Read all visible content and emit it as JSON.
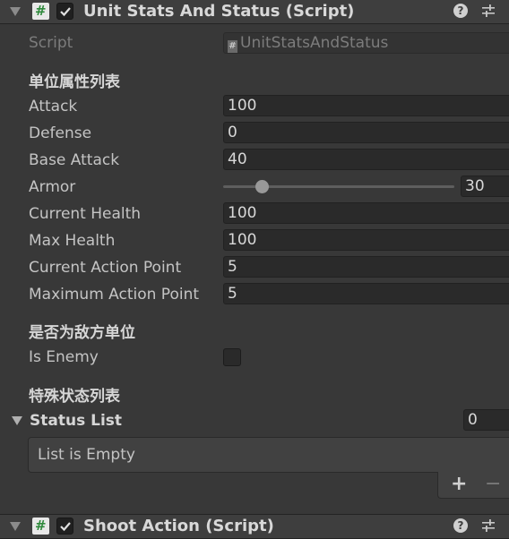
{
  "component1": {
    "title": "Unit Stats And Status (Script)",
    "script_label": "Script",
    "script_value": "UnitStatsAndStatus"
  },
  "section_attributes": "单位属性列表",
  "fields": {
    "attack": {
      "label": "Attack",
      "value": "100"
    },
    "defense": {
      "label": "Defense",
      "value": "0"
    },
    "base_attack": {
      "label": "Base Attack",
      "value": "40"
    },
    "armor": {
      "label": "Armor",
      "value": "30",
      "slider_fraction": 0.16
    },
    "current_health": {
      "label": "Current Health",
      "value": "100"
    },
    "max_health": {
      "label": "Max Health",
      "value": "100"
    },
    "current_action_point": {
      "label": "Current Action Point",
      "value": "5"
    },
    "maximum_action_point": {
      "label": "Maximum Action Point",
      "value": "5"
    }
  },
  "section_enemy": "是否为敌方单位",
  "is_enemy": {
    "label": "Is Enemy",
    "checked": false
  },
  "section_status": "特殊状态列表",
  "status_list": {
    "label": "Status List",
    "size": "0",
    "empty_text": "List is Empty",
    "add_label": "+",
    "remove_label": "−"
  },
  "component2": {
    "title": "Shoot Action (Script)"
  },
  "icons": {
    "foldout": "foldout-arrow-icon",
    "script": "csharp-script-icon",
    "toggle": "checkmark-icon",
    "help": "help-icon",
    "settings": "settings-sliders-icon"
  },
  "colors": {
    "background": "#383838",
    "header": "#3e3e3e",
    "field": "#2a2a2a",
    "text": "#c4c4c4",
    "script_icon_accent": "#2f8a3c"
  }
}
